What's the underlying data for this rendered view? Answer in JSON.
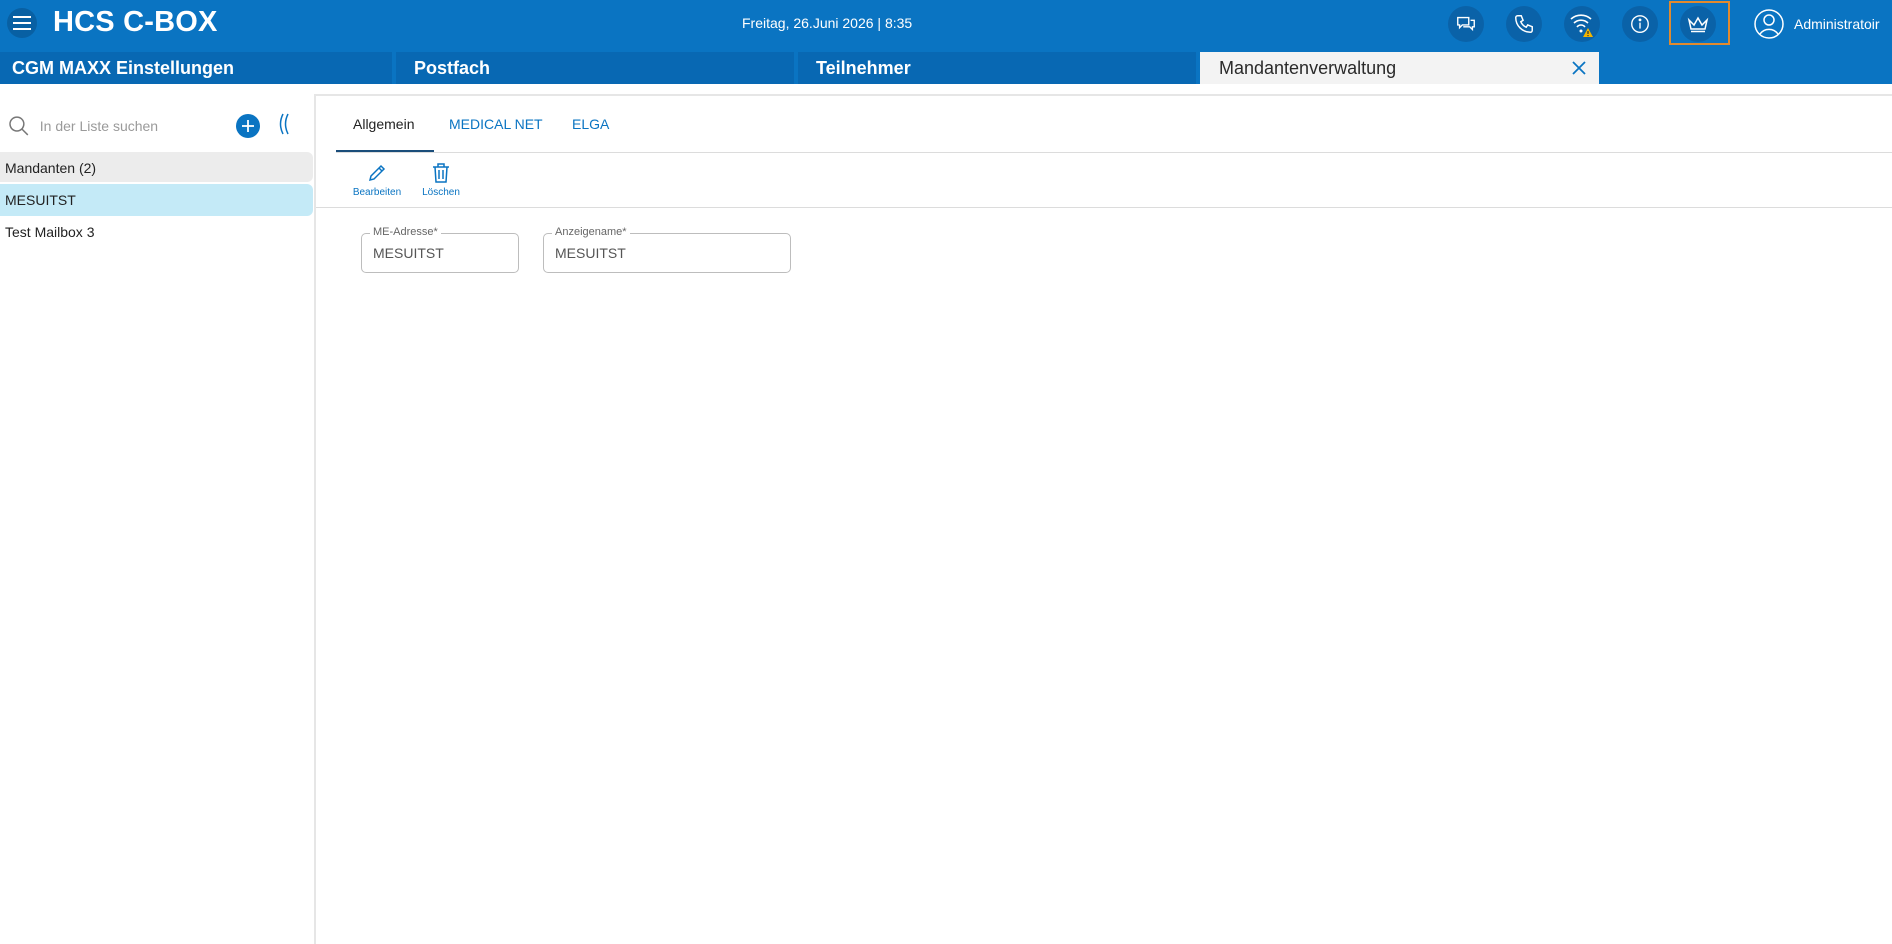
{
  "header": {
    "app_title": "HCS C-BOX",
    "datetime": "Freitag, 26.Juni 2026 | 8:35",
    "user_name": "Administratoir",
    "icons": [
      "chat-icon",
      "phone-icon",
      "wifi-warning-icon",
      "info-icon",
      "crown-icon"
    ],
    "accent_color": "#0a74c2",
    "highlight_color": "#e08a2e",
    "warning_color": "#f2b500"
  },
  "tabs": [
    {
      "label": "CGM MAXX Einstellungen"
    },
    {
      "label": "Postfach"
    },
    {
      "label": "Teilnehmer"
    },
    {
      "label": "Mandantenverwaltung",
      "active": true
    }
  ],
  "sidebar": {
    "search_placeholder": "In der Liste suchen",
    "list_header": "Mandanten (2)",
    "items": [
      {
        "label": "MESUITST",
        "selected": true
      },
      {
        "label": "Test Mailbox 3"
      }
    ]
  },
  "main": {
    "tabs": [
      {
        "label": "Allgemein",
        "active": true
      },
      {
        "label": "MEDICAL NET"
      },
      {
        "label": "ELGA"
      }
    ],
    "toolbar": {
      "edit_label": "Bearbeiten",
      "delete_label": "Löschen"
    },
    "fields": [
      {
        "label": "ME-Adresse*",
        "value": "MESUITST"
      },
      {
        "label": "Anzeigename*",
        "value": "MESUITST"
      }
    ]
  }
}
